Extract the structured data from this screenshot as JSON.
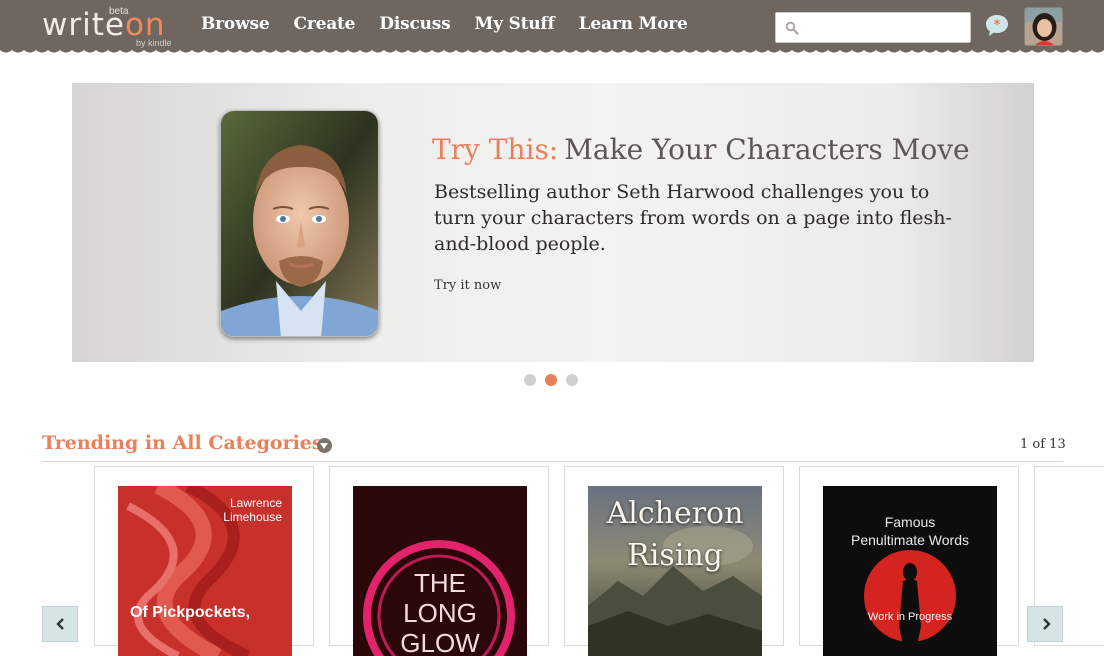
{
  "header": {
    "logo": {
      "prefix": "writ",
      "dot": "e",
      "suffix": "on",
      "beta": "beta",
      "by": "by kindle"
    },
    "nav": [
      "Browse",
      "Create",
      "Discuss",
      "My Stuff",
      "Learn More"
    ],
    "search": {
      "placeholder": "",
      "value": "",
      "icon": "search-icon"
    },
    "notifications_icon": "chat-bubble-icon",
    "avatar": "user-avatar",
    "colors": {
      "bar": "#6f6660",
      "accent": "#e8805a"
    }
  },
  "banner": {
    "title_prefix": "Try This:",
    "title": "Make Your Characters Move",
    "description": "Bestselling author Seth Harwood challenges you to turn your characters from words on a page into flesh-and-blood people.",
    "link": "Try it now",
    "slides": 3,
    "active_slide": 2
  },
  "trending": {
    "title": "Trending in All Categories",
    "pager": "1 of 13",
    "books": [
      {
        "author": "Lawrence Limehouse",
        "title": "Of Pickpockets,",
        "cover_color": "#c8302c"
      },
      {
        "title_lines": [
          "THE",
          "LONG",
          "GLOW"
        ],
        "cover_color": "#2a0708"
      },
      {
        "title_lines": [
          "Alcheron",
          "Rising"
        ],
        "cover_color": "#7c7a66"
      },
      {
        "title_lines": [
          "Famous",
          "Penultimate Words"
        ],
        "subtitle": "Work in Progress",
        "cover_color": "#0d0d0d"
      }
    ]
  }
}
